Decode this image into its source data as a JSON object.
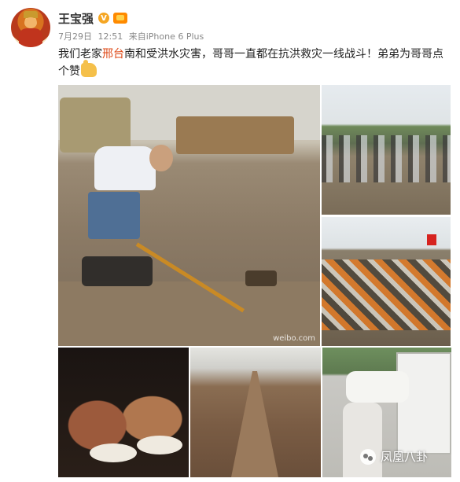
{
  "post": {
    "username": "王宝强",
    "verified_badge": "V",
    "date": "7月29日",
    "time": "12:51",
    "source": "来自iPhone 6 Plus",
    "text_before": "我们老家",
    "text_highlight": "邢台",
    "text_after": "南和受洪水灾害，哥哥一直都在抗洪救灾一线战斗！弟弟为哥哥点个赞",
    "highlight_color": "#dd4411"
  },
  "photos": {
    "main_watermark": "weibo.com"
  },
  "watermark": {
    "brand": "凤凰八卦",
    "icon": "wechat-icon"
  }
}
